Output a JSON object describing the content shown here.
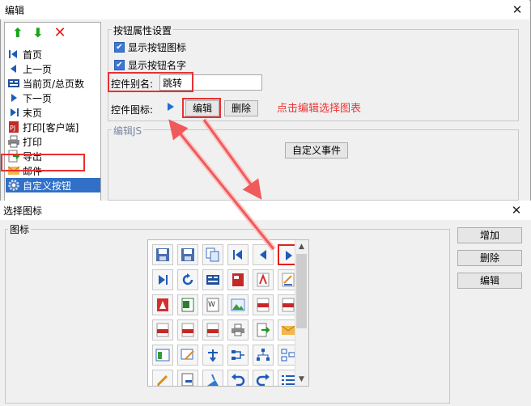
{
  "colors": {
    "accent": "#3070c8",
    "annotation_red": "#e83030",
    "hint_red": "#ee3434",
    "arrow_green": "#1aa31a"
  },
  "edit_window": {
    "title": "编辑",
    "close_icon": "close-icon",
    "toolbar": {
      "up_icon": "arrow-up-icon",
      "down_icon": "arrow-down-icon",
      "delete_icon": "delete-x-icon",
      "up_glyph": "⬆",
      "down_glyph": "⬇",
      "delete_glyph": "✕"
    },
    "items": [
      {
        "label": "首页",
        "icon": "first-page-icon"
      },
      {
        "label": "上一页",
        "icon": "prev-page-icon"
      },
      {
        "label": "当前页/总页数",
        "icon": "page-count-icon"
      },
      {
        "label": "下一页",
        "icon": "next-page-icon"
      },
      {
        "label": "末页",
        "icon": "last-page-icon"
      },
      {
        "label": "打印[客户端]",
        "icon": "print-client-icon"
      },
      {
        "label": "打印",
        "icon": "printer-icon"
      },
      {
        "label": "导出",
        "icon": "export-icon"
      },
      {
        "label": "邮件",
        "icon": "mail-icon"
      },
      {
        "label": "自定义按钮",
        "icon": "gear-icon",
        "selected": true
      }
    ],
    "button_props": {
      "group_title": "按钮属性设置",
      "show_icon_label": "显示按钮图标",
      "show_icon_checked": true,
      "show_name_label": "显示按钮名字",
      "show_name_checked": true,
      "alias_label": "控件别名:",
      "alias_value": "跳转",
      "icon_label": "控件图标:",
      "icon_preview": "play-right-icon",
      "edit_button": "编辑",
      "delete_button": "删除",
      "hint": "点击编辑选择图表"
    },
    "js_group": {
      "title": "编辑JS",
      "custom_event_button": "自定义事件"
    }
  },
  "icon_dialog": {
    "title": "选择图标",
    "close_icon": "close-icon",
    "group_title": "图标",
    "add_button": "增加",
    "remove_button": "删除",
    "edit_button": "编辑",
    "selected_icon": "play-right-icon",
    "icons": [
      "save-icon",
      "save-as-icon",
      "copy-pages-icon",
      "first-page-icon",
      "prev-page-icon",
      "play-right-icon",
      "last-page-icon",
      "refresh-icon",
      "page-view-icon",
      "pdf-red-icon",
      "pdf-icon",
      "edit-doc-icon",
      "acrobat-icon",
      "excel-icon",
      "word-icon",
      "image-icon",
      "html-icon",
      "svg-icon",
      "jpg-icon",
      "gif-icon",
      "png-icon",
      "printer-icon",
      "export-green-icon",
      "mail-icon",
      "form-icon",
      "edit-form-icon",
      "tree-icon",
      "flow-icon",
      "hierarchy-icon",
      "split-icon",
      "pencil-icon",
      "minus-doc-icon",
      "blue-brush-icon",
      "undo-icon",
      "redo-icon",
      "list-icon"
    ]
  }
}
